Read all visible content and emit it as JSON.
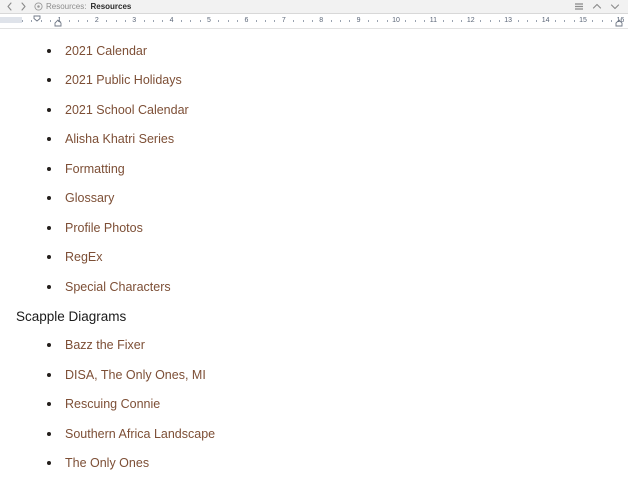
{
  "titlebar": {
    "back_icon": "chevron-left-icon",
    "forward_icon": "chevron-right-icon",
    "doc_icon": "target-circle-icon",
    "breadcrumb_parent": "Resources:",
    "breadcrumb_current": "Resources",
    "right_icons": [
      {
        "name": "layout-list-icon"
      },
      {
        "name": "chevron-up-icon"
      },
      {
        "name": "chevron-down-icon"
      }
    ]
  },
  "ruler": {
    "numbers": [
      "1",
      "2",
      "3",
      "4",
      "5",
      "6",
      "7",
      "8",
      "9",
      "10",
      "11",
      "12",
      "13",
      "14",
      "15",
      "16"
    ],
    "first_line_indent_marker": "first-line-indent-marker",
    "left_indent_marker": "left-indent-marker",
    "right_indent_marker": "right-indent-marker"
  },
  "document": {
    "list_before": [
      "2021 Calendar",
      "2021 Public Holidays",
      "2021 School Calendar",
      "Alisha Khatri Series",
      "Formatting",
      "Glossary",
      "Profile Photos",
      "RegEx",
      "Special Characters"
    ],
    "heading": "Scapple Diagrams",
    "list_after": [
      "Bazz the Fixer",
      "DISA, The Only Ones, MI",
      "Rescuing Connie",
      "Southern Africa Landscape",
      "The Only Ones"
    ]
  },
  "colors": {
    "link_text": "#7d4f36",
    "heading_text": "#1a1a1a",
    "chrome_bg": "#f2f2f2"
  }
}
